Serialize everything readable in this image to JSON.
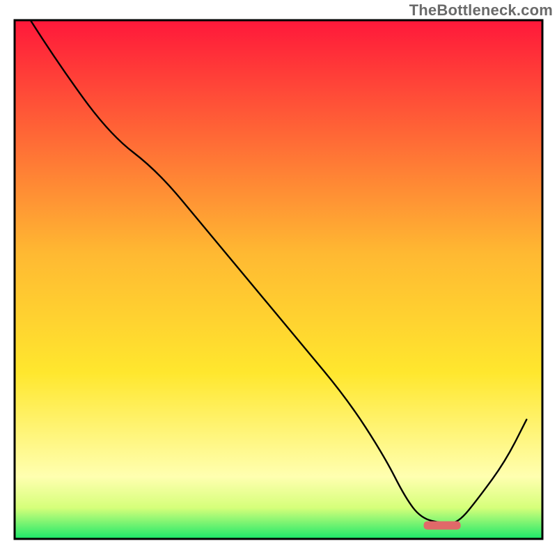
{
  "watermark": "TheBottleneck.com",
  "chart_data": {
    "type": "line",
    "title": "",
    "xlabel": "",
    "ylabel": "",
    "xlim": [
      0,
      100
    ],
    "ylim": [
      0,
      100
    ],
    "series": [
      {
        "name": "bottleneck-curve",
        "x": [
          3,
          8,
          18,
          27,
          36,
          45,
          54,
          63,
          70,
          74,
          77,
          81,
          84,
          88,
          93,
          97
        ],
        "values": [
          100,
          92,
          78,
          71,
          60,
          49,
          38,
          27,
          16,
          8,
          4,
          3,
          3,
          8,
          15,
          23
        ]
      }
    ],
    "marker": {
      "name": "optimal-range",
      "x_start": 77.5,
      "x_end": 84.5,
      "y": 2.6,
      "color": "#e06969"
    },
    "background": {
      "top_color": "#ff183a",
      "mid_upper_color": "#ffb932",
      "mid_color": "#ffe72e",
      "band_color": "#ffffb0",
      "bottom_color": "#1ae86a"
    },
    "axes": {
      "show_ticks": false,
      "show_grid": false,
      "border_color": "#000000",
      "border_width": 3
    }
  }
}
